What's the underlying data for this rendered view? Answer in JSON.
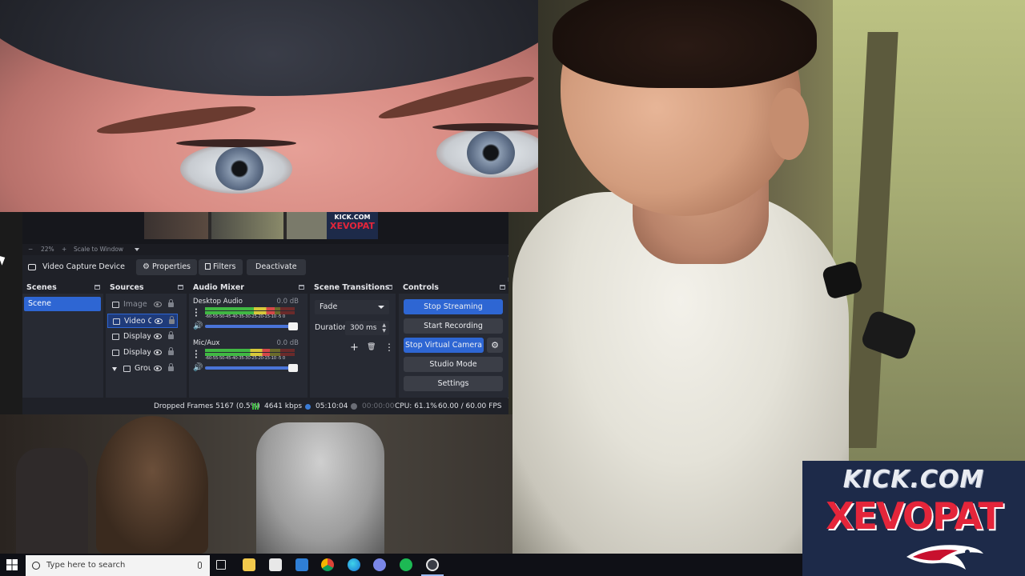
{
  "obs": {
    "preview": {
      "zoom": "22%",
      "zoom_minus": "−",
      "zoom_plus": "+",
      "scale_mode": "Scale to Window",
      "thumb_logo_top": "KICK.COM",
      "thumb_logo_bottom": "XEVOPAT"
    },
    "context_bar": {
      "source_name": "Video Capture Device",
      "properties_label": "Properties",
      "filters_label": "Filters",
      "deactivate_label": "Deactivate"
    },
    "docks": {
      "scenes_title": "Scenes",
      "sources_title": "Sources",
      "audio_mixer_title": "Audio Mixer",
      "transitions_title": "Scene Transitions",
      "controls_title": "Controls"
    },
    "scenes": {
      "items": [
        "Scene"
      ]
    },
    "sources": {
      "items": [
        "Image",
        "Video C",
        "Display",
        "Display",
        "Grou"
      ]
    },
    "audio_mixer": {
      "tracks": [
        {
          "name": "Desktop Audio",
          "db": "0.0 dB",
          "level": 0.78
        },
        {
          "name": "Mic/Aux",
          "db": "0.0 dB",
          "level": 0.72
        }
      ],
      "tick_labels": "-60-55-50-45-40-35-30-25-20-15-10 -5 0"
    },
    "transitions": {
      "selected": "Fade",
      "duration_label": "Duration",
      "duration_value": "300 ms"
    },
    "controls": {
      "stop_streaming": "Stop Streaming",
      "start_recording": "Start Recording",
      "stop_virtual_camera": "Stop Virtual Camera",
      "studio_mode": "Studio Mode",
      "settings": "Settings"
    },
    "status": {
      "dropped_frames": "Dropped Frames 5167 (0.5%)",
      "bitrate": "4641 kbps",
      "stream_time": "05:10:04",
      "record_time": "00:00:00",
      "cpu": "CPU: 61.1%",
      "fps": "60.00 / 60.00 FPS"
    }
  },
  "overlay": {
    "kick_top": "KICK.COM",
    "kick_bottom": "XEVOPAT"
  },
  "taskbar": {
    "search_placeholder": "Type here to search",
    "apps": [
      "task-view",
      "file-explorer",
      "store",
      "mail",
      "chrome",
      "edge",
      "discord",
      "spotify",
      "obs"
    ]
  },
  "colors": {
    "obs_accent": "#2e66d3",
    "kick_navy": "#1d2a49",
    "kick_red": "#e4253a"
  }
}
